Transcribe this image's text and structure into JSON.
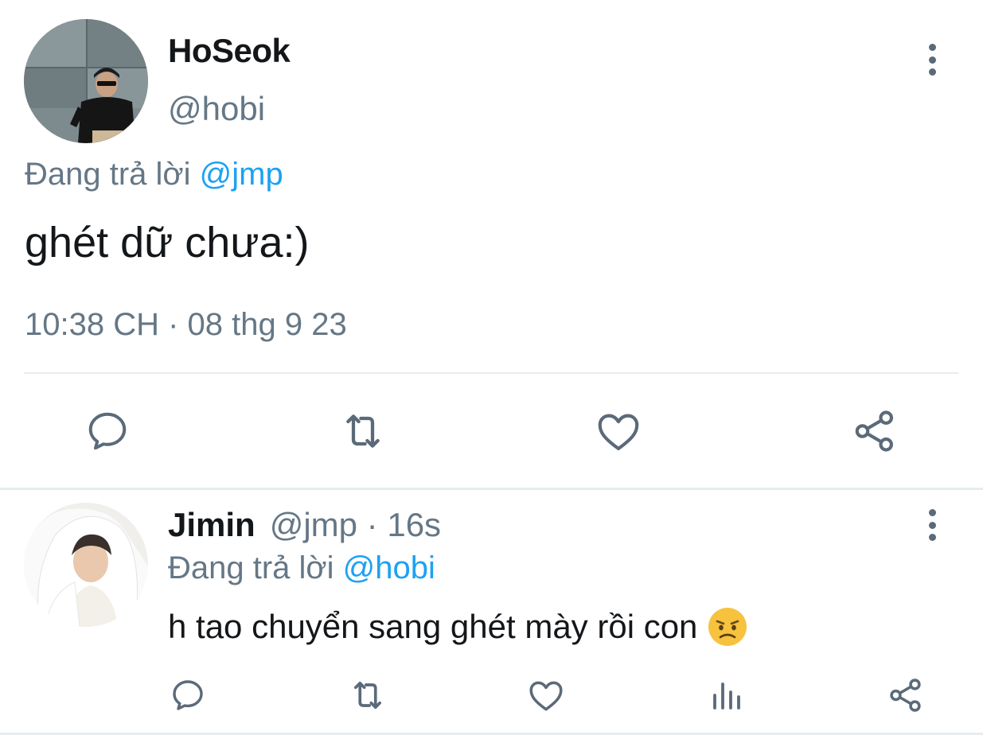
{
  "main_tweet": {
    "display_name": "HoSeok",
    "handle": "@hobi",
    "replying_prefix": "Đang trả lời",
    "replying_to": "@jmp",
    "text": "ghét dữ chưa:)",
    "timestamp": "10:38 CH · 08 thg 9 23",
    "actions": [
      "reply-icon",
      "retweet-icon",
      "like-icon",
      "share-icon"
    ]
  },
  "reply_tweet": {
    "display_name": "Jimin",
    "meta": "@jmp · 16s",
    "replying_prefix": "Đang trả lời",
    "replying_to": "@hobi",
    "text": "h tao chuyển sang ghét mày rồi con",
    "emoji": "angry-face",
    "actions": [
      "reply-icon",
      "retweet-icon",
      "like-icon",
      "analytics-icon",
      "share-icon"
    ]
  },
  "colors": {
    "text_primary": "#14171a",
    "text_secondary": "#657786",
    "mention": "#1da1f2",
    "icon": "#5b6a79",
    "divider": "#e6ecf0"
  }
}
